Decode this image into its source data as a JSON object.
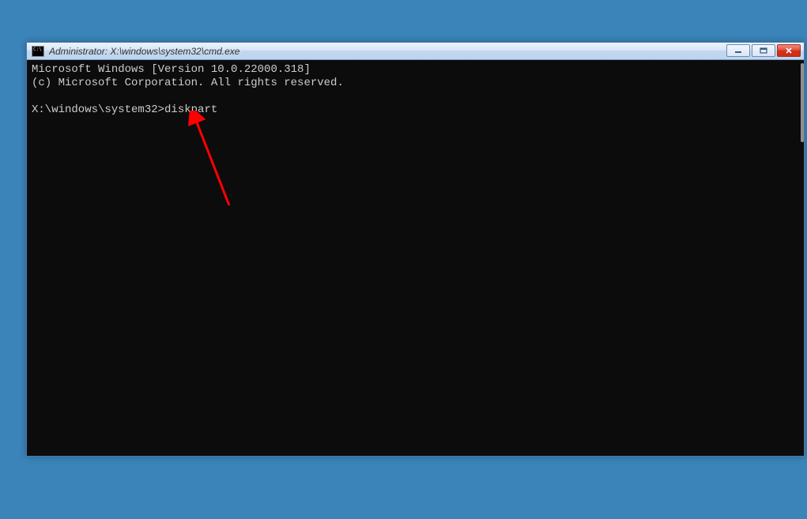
{
  "window": {
    "title": "Administrator: X:\\windows\\system32\\cmd.exe"
  },
  "terminal": {
    "line1": "Microsoft Windows [Version 10.0.22000.318]",
    "line2": "(c) Microsoft Corporation. All rights reserved.",
    "prompt": "X:\\windows\\system32>",
    "command": "diskpart"
  }
}
